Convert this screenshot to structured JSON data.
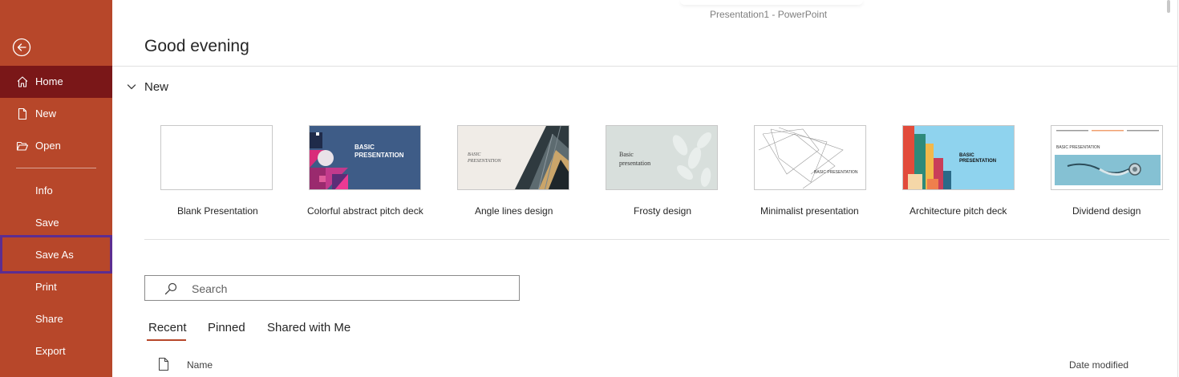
{
  "window": {
    "title": "Presentation1  -  PowerPoint"
  },
  "sidebar": {
    "back_icon": "back-arrow-circle-icon",
    "items": [
      {
        "label": "Home",
        "icon": "home-icon",
        "active": true
      },
      {
        "label": "New",
        "icon": "new-document-icon"
      },
      {
        "label": "Open",
        "icon": "open-folder-icon"
      },
      {
        "label": "Info"
      },
      {
        "label": "Save"
      },
      {
        "label": "Save As",
        "highlighted": true
      },
      {
        "label": "Print"
      },
      {
        "label": "Share"
      },
      {
        "label": "Export"
      }
    ]
  },
  "main": {
    "greeting": "Good evening",
    "new_section": {
      "heading": "New",
      "toggle_icon": "chevron-down-icon",
      "templates": [
        {
          "label": "Blank Presentation"
        },
        {
          "label": "Colorful abstract pitch deck",
          "thumb_text": "BASIC\nPRESENTATION"
        },
        {
          "label": "Angle lines design",
          "thumb_text": "BASIC\nPRESENTATION"
        },
        {
          "label": "Frosty design",
          "thumb_text": "Basic\npresentation"
        },
        {
          "label": "Minimalist presentation",
          "thumb_text": "BASIC PRESENTATION"
        },
        {
          "label": "Architecture pitch deck",
          "thumb_text": "BASIC\nPRESENTATION"
        },
        {
          "label": "Dividend design",
          "thumb_text": "BASIC PRESENTATION"
        }
      ]
    },
    "search": {
      "placeholder": "Search",
      "value": ""
    },
    "tabs": [
      {
        "label": "Recent",
        "active": true
      },
      {
        "label": "Pinned"
      },
      {
        "label": "Shared with Me"
      }
    ],
    "file_list": {
      "columns": [
        "Name",
        "Date modified"
      ]
    }
  },
  "colors": {
    "accent": "#b7472a",
    "active_nav": "#7a1718",
    "highlight_border": "#5c2d91"
  }
}
